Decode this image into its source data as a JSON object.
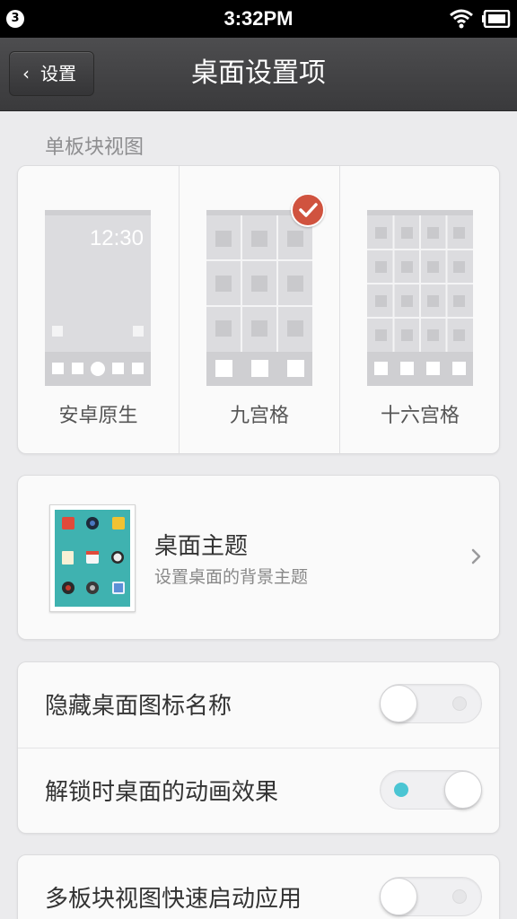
{
  "status_bar": {
    "notification_count": "3",
    "time": "3:32PM"
  },
  "header": {
    "back_label": "设置",
    "title": "桌面设置项"
  },
  "section_label": "单板块视图",
  "layouts": [
    {
      "label": "安卓原生",
      "clock": "12:30",
      "selected": false
    },
    {
      "label": "九宫格",
      "selected": true
    },
    {
      "label": "十六宫格",
      "selected": false
    }
  ],
  "theme": {
    "title": "桌面主题",
    "subtitle": "设置桌面的背景主题"
  },
  "toggles": [
    {
      "label": "隐藏桌面图标名称",
      "on": false
    },
    {
      "label": "解锁时桌面的动画效果",
      "on": true
    },
    {
      "label": "多板块视图快速启动应用",
      "on": false
    }
  ],
  "colors": {
    "accent_check": "#d0533f",
    "toggle_on_dot": "#4bc5d3",
    "theme_wallpaper": "#3fb2b0"
  }
}
